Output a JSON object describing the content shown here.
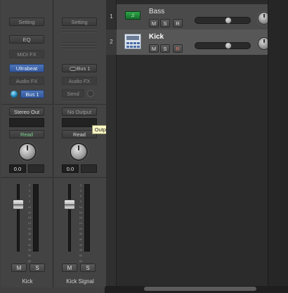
{
  "mixer": {
    "strips": [
      {
        "setting": "Setting",
        "eq": "EQ",
        "midi_fx": "MIDI FX",
        "instrument": "Ultrabeat",
        "audio_fx": "Audio FX",
        "send": "Bus 1",
        "output": "Stereo Out",
        "automation": "Read",
        "volume": "0.0",
        "mute": "M",
        "solo": "S",
        "name": "Kick"
      },
      {
        "setting": "Setting",
        "input": "Bus 1",
        "audio_fx": "Audio FX",
        "send": "Send",
        "output": "No Output",
        "automation": "Read",
        "volume": "0.0",
        "mute": "M",
        "solo": "S",
        "name": "Kick Signal"
      }
    ],
    "meter_scale": [
      "0",
      "3",
      "6",
      "9",
      "12",
      "15",
      "18",
      "21",
      "24",
      "30",
      "35",
      "40",
      "45",
      "50",
      "60"
    ]
  },
  "tooltip": {
    "text": "Output"
  },
  "tracks": [
    {
      "number": "1",
      "name": "Bass",
      "icon": "green-keyboard-icon",
      "mute": "M",
      "solo": "S",
      "record": "R",
      "volume_level": 0.6,
      "selected": false
    },
    {
      "number": "2",
      "name": "Kick",
      "icon": "drum-machine-icon",
      "mute": "M",
      "solo": "S",
      "record": "R",
      "volume_level": 0.6,
      "selected": true
    }
  ],
  "colors": {
    "instrument_slot": "#3e64a8",
    "read_green": "#7dd88d",
    "record_red": "#e27b6a",
    "tooltip_bg": "#fbf7c4"
  }
}
